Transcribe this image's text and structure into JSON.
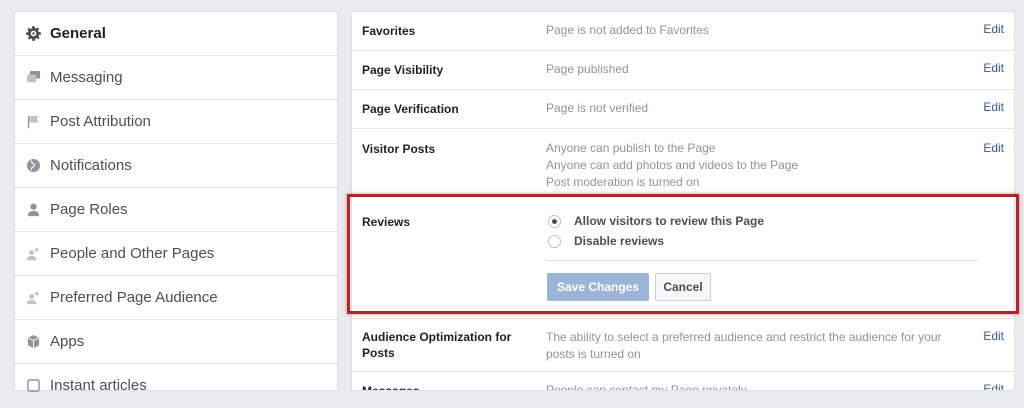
{
  "sidebar": {
    "items": [
      {
        "label": "General",
        "icon": "gear-icon"
      },
      {
        "label": "Messaging",
        "icon": "messaging-icon"
      },
      {
        "label": "Post Attribution",
        "icon": "flag-icon"
      },
      {
        "label": "Notifications",
        "icon": "globe-icon"
      },
      {
        "label": "Page Roles",
        "icon": "person-icon"
      },
      {
        "label": "People and Other Pages",
        "icon": "people-icon"
      },
      {
        "label": "Preferred Page Audience",
        "icon": "people-icon"
      },
      {
        "label": "Apps",
        "icon": "cube-icon"
      },
      {
        "label": "Instant articles",
        "icon": "article-icon"
      }
    ]
  },
  "settings": {
    "favorites": {
      "label": "Favorites",
      "value": "Page is not added to Favorites",
      "edit": "Edit"
    },
    "visibility": {
      "label": "Page Visibility",
      "value": "Page published",
      "edit": "Edit"
    },
    "verification": {
      "label": "Page Verification",
      "value": "Page is not verified",
      "edit": "Edit"
    },
    "visitor_posts": {
      "label": "Visitor Posts",
      "values": [
        "Anyone can publish to the Page",
        "Anyone can add photos and videos to the Page",
        "Post moderation is turned on"
      ],
      "edit": "Edit"
    },
    "reviews": {
      "label": "Reviews",
      "options": [
        {
          "label": "Allow visitors to review this Page",
          "selected": true
        },
        {
          "label": "Disable reviews",
          "selected": false
        }
      ],
      "save_label": "Save Changes",
      "cancel_label": "Cancel"
    },
    "audience": {
      "label": "Audience Optimization for Posts",
      "value": "The ability to select a preferred audience and restrict the audience for your posts is turned on",
      "edit": "Edit"
    },
    "messages": {
      "label": "Messages",
      "value": "People can contact my Page privately",
      "edit": "Edit"
    }
  },
  "colors": {
    "link": "#365899",
    "highlight_border": "#b3232b",
    "save_button": "#9cb4d8"
  }
}
